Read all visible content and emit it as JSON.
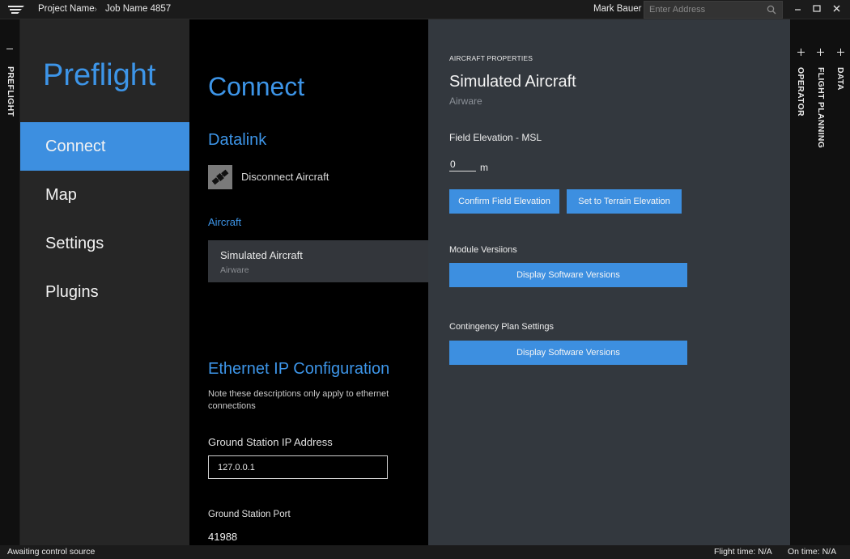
{
  "titlebar": {
    "project": "Project Name",
    "job": "Job Name 4857",
    "user": "Mark Bauer",
    "address_placeholder": "Enter Address"
  },
  "left_tab": {
    "label": "PREFLIGHT"
  },
  "nav": {
    "title": "Preflight",
    "items": [
      {
        "label": "Connect",
        "active": true
      },
      {
        "label": "Map",
        "active": false
      },
      {
        "label": "Settings",
        "active": false
      },
      {
        "label": "Plugins",
        "active": false
      }
    ]
  },
  "connect": {
    "title": "Connect",
    "datalink_heading": "Datalink",
    "disconnect_label": "Disconnect Aircraft",
    "aircraft_heading": "Aircraft",
    "aircraft_card": {
      "name": "Simulated Aircraft",
      "maker": "Airware"
    },
    "ethernet_heading": "Ethernet IP Configuration",
    "ethernet_note": "Note these descriptions only apply to ethernet connections",
    "ip_label": "Ground Station IP Address",
    "ip_value": "127.0.0.1",
    "port_label": "Ground Station Port",
    "port_value": "41988"
  },
  "properties": {
    "caption": "AIRCRAFT PROPERTIES",
    "name": "Simulated Aircraft",
    "maker": "Airware",
    "field_elevation_label": "Field Elevation -  MSL",
    "elevation_value": "0",
    "elevation_unit": "m",
    "confirm_button": "Confirm Field Elevation",
    "terrain_button": "Set to Terrain Elevation",
    "module_versions_label": "Module Versiions",
    "module_versions_button": "Display Software Versions",
    "contingency_label": "Contingency Plan Settings",
    "contingency_button": "Display Software Versions"
  },
  "right_tabs": [
    {
      "label": "OPERATOR"
    },
    {
      "label": "FLIGHT PLANNING"
    },
    {
      "label": "DATA"
    }
  ],
  "status": {
    "left": "Awaiting control source",
    "flight_time": "Flight time: N/A",
    "on_time": "On time: N/A"
  },
  "colors": {
    "accent": "#3d8fe0",
    "nav_bg": "#262626",
    "panel_bg": "#33383e"
  }
}
